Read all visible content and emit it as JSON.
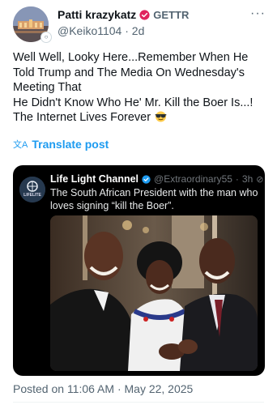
{
  "author": {
    "display_name": "Patti krazykatz",
    "badge_label": "GETTR",
    "handle": "@Keiko1104",
    "separator": "·",
    "age": "2d",
    "verified_color": "#e0245e"
  },
  "post": {
    "lines": [
      "Well Well, Looky Here...Remember When He Told Trump and The Media On Wednesday's Meeting That",
      "He Didn't Know Who He' Mr. Kill the Boer Is...!",
      "The Internet Lives Forever"
    ],
    "emoji": "sunglasses-face",
    "translate_label": "Translate post",
    "timestamp": "Posted on 11:06 AM · May 22, 2025"
  },
  "quote": {
    "display_name": "Life Light Channel",
    "handle": "@Extraordinary55",
    "separator": "·",
    "age": "3h",
    "avatar_text": "LIFELITE",
    "text": "The South African President with the man who loves signing “kill the Boer”.",
    "verified_color": "#1d9bf0"
  },
  "colors": {
    "accent": "#1d9bf0",
    "text_primary": "#0f1419",
    "text_secondary": "#536471"
  }
}
